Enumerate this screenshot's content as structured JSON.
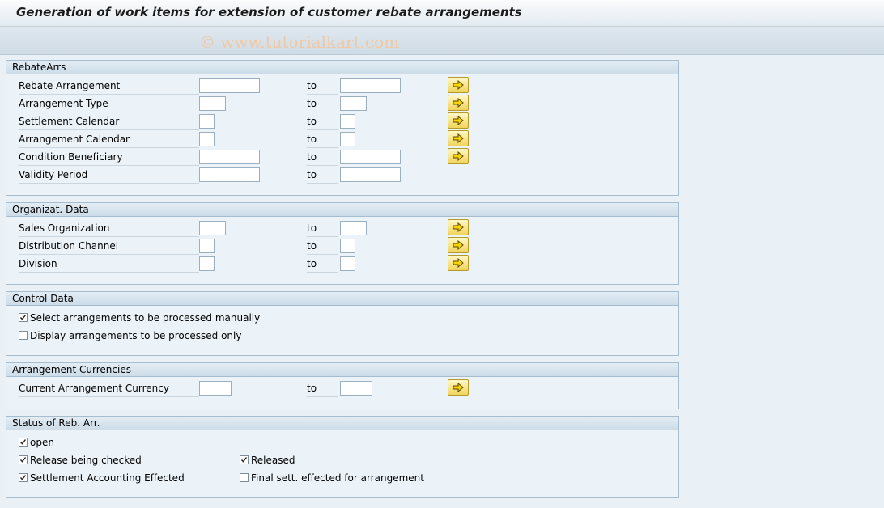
{
  "window": {
    "title": "Generation of work items for extension of customer rebate arrangements",
    "watermark": "© www.tutorialkart.com"
  },
  "range_to_label": "to",
  "groups": {
    "rebate_arrs": {
      "title": "RebateArrs",
      "fields": [
        {
          "label": "Rebate Arrangement",
          "from": "",
          "to": ""
        },
        {
          "label": "Arrangement Type",
          "from": "",
          "to": ""
        },
        {
          "label": "Settlement Calendar",
          "from": "",
          "to": ""
        },
        {
          "label": "Arrangement Calendar",
          "from": "",
          "to": ""
        },
        {
          "label": "Condition Beneficiary",
          "from": "",
          "to": ""
        },
        {
          "label": "Validity Period",
          "from": "",
          "to": ""
        }
      ]
    },
    "org_data": {
      "title": "Organizat. Data",
      "fields": [
        {
          "label": "Sales Organization",
          "from": "",
          "to": ""
        },
        {
          "label": "Distribution Channel",
          "from": "",
          "to": ""
        },
        {
          "label": "Division",
          "from": "",
          "to": ""
        }
      ]
    },
    "control_data": {
      "title": "Control Data",
      "options": [
        {
          "label": "Select arrangements to be processed manually",
          "checked": true
        },
        {
          "label": "Display arrangements to be processed only",
          "checked": false
        }
      ]
    },
    "currencies": {
      "title": "Arrangement Currencies",
      "fields": [
        {
          "label": "Current Arrangement Currency",
          "from": "",
          "to": ""
        }
      ]
    },
    "status": {
      "title": "Status of Reb. Arr.",
      "options": [
        {
          "label": "open",
          "checked": true
        },
        {
          "label": "Release being checked",
          "checked": true
        },
        {
          "label": "Released",
          "checked": true
        },
        {
          "label": "Settlement Accounting Effected",
          "checked": true
        },
        {
          "label": "Final sett. effected for arrangement",
          "checked": false
        }
      ]
    }
  },
  "icons": {
    "multiple_selection": "arrow-right-icon",
    "accent_yellow": "#f1d45a",
    "group_border": "#a7bccd"
  }
}
